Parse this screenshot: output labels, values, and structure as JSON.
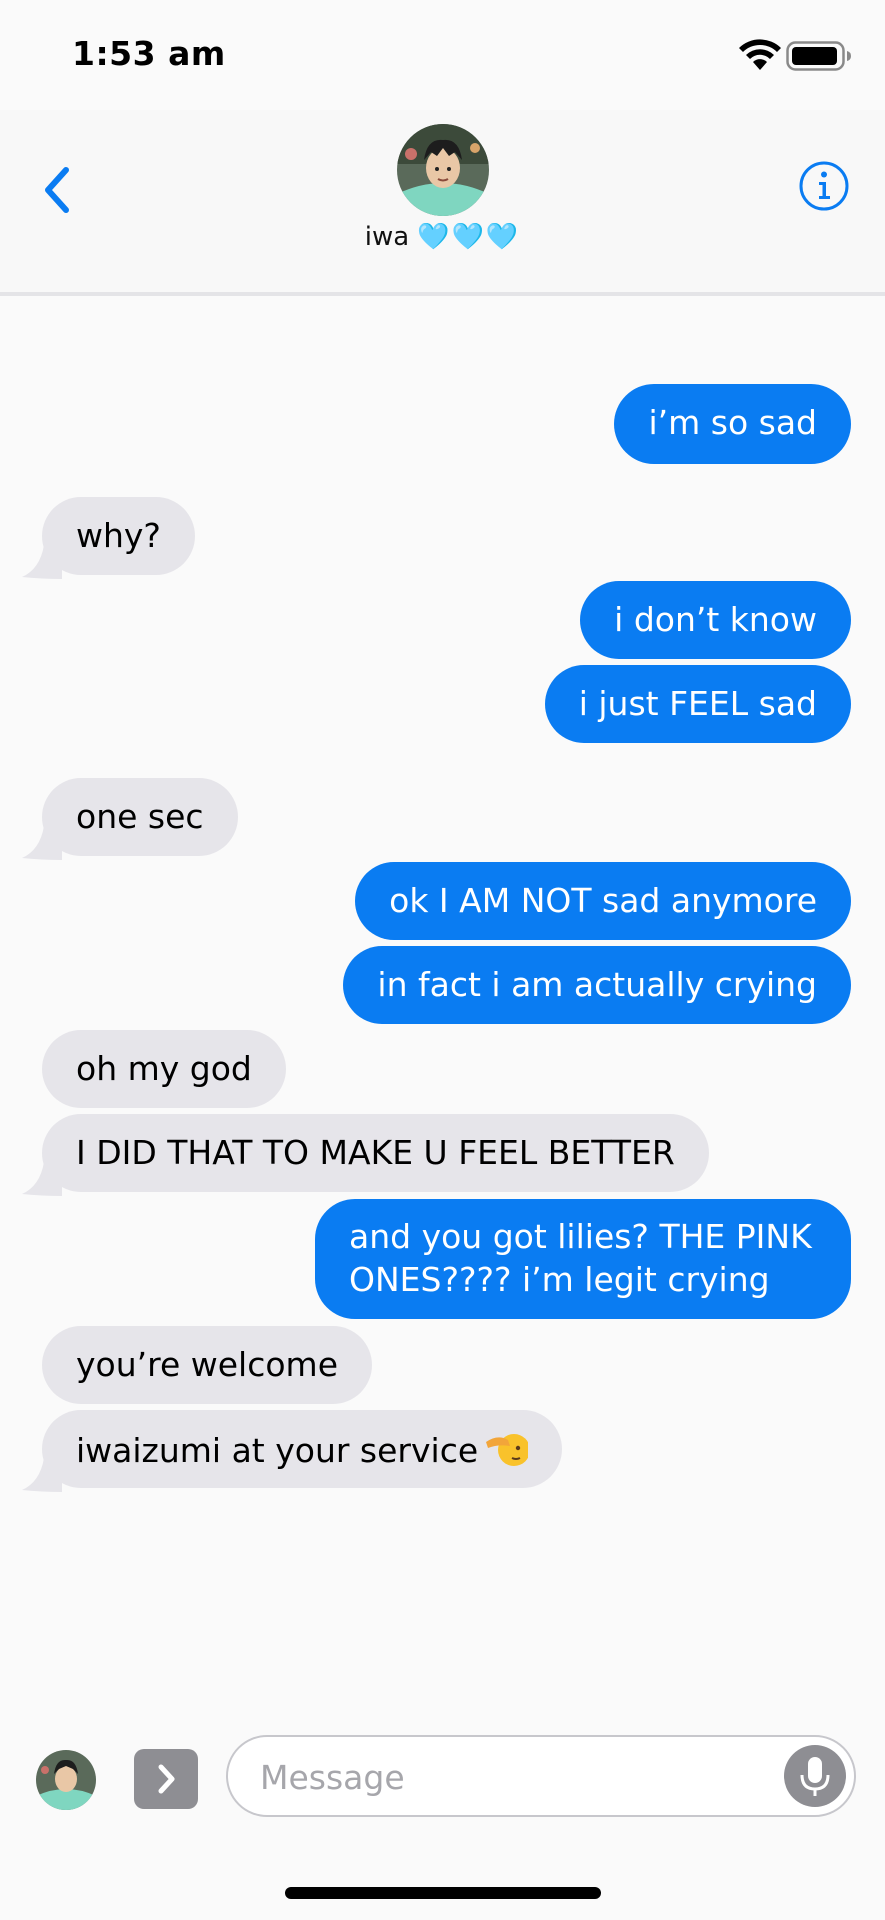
{
  "status_bar": {
    "time": "1:53 am",
    "wifi_icon": "wifi-icon",
    "battery_icon": "battery-icon"
  },
  "header": {
    "contact_name": "iwa",
    "contact_hearts": "🩵🩵🩵",
    "back_icon": "chevron-left-icon",
    "info_icon": "info-icon"
  },
  "messages": [
    {
      "direction": "out",
      "text": "i’m so sad"
    },
    {
      "direction": "in",
      "text": "why?"
    },
    {
      "direction": "out",
      "text": "i don’t know"
    },
    {
      "direction": "out",
      "text": "i just FEEL sad"
    },
    {
      "direction": "in",
      "text": "one sec"
    },
    {
      "direction": "out",
      "text": "ok I AM NOT sad anymore"
    },
    {
      "direction": "out",
      "text": "in fact i am actually crying"
    },
    {
      "direction": "in",
      "text": "oh my god"
    },
    {
      "direction": "in",
      "text": "I DID THAT TO MAKE U FEEL BETTER"
    },
    {
      "direction": "out",
      "text": "and you got lilies? THE PINK ONES???? i’m legit crying"
    },
    {
      "direction": "in",
      "text": "you’re welcome"
    },
    {
      "direction": "in",
      "text": "iwaizumi at your service",
      "emoji": "saluting-face-icon"
    }
  ],
  "composer": {
    "placeholder": "Message",
    "value": "",
    "apps_icon": "chevron-right-icon",
    "mic_icon": "microphone-icon"
  },
  "colors": {
    "accent": "#0a7cf2",
    "incoming_bubble": "#e6e5ea",
    "outgoing_bubble": "#0a7cf2"
  }
}
